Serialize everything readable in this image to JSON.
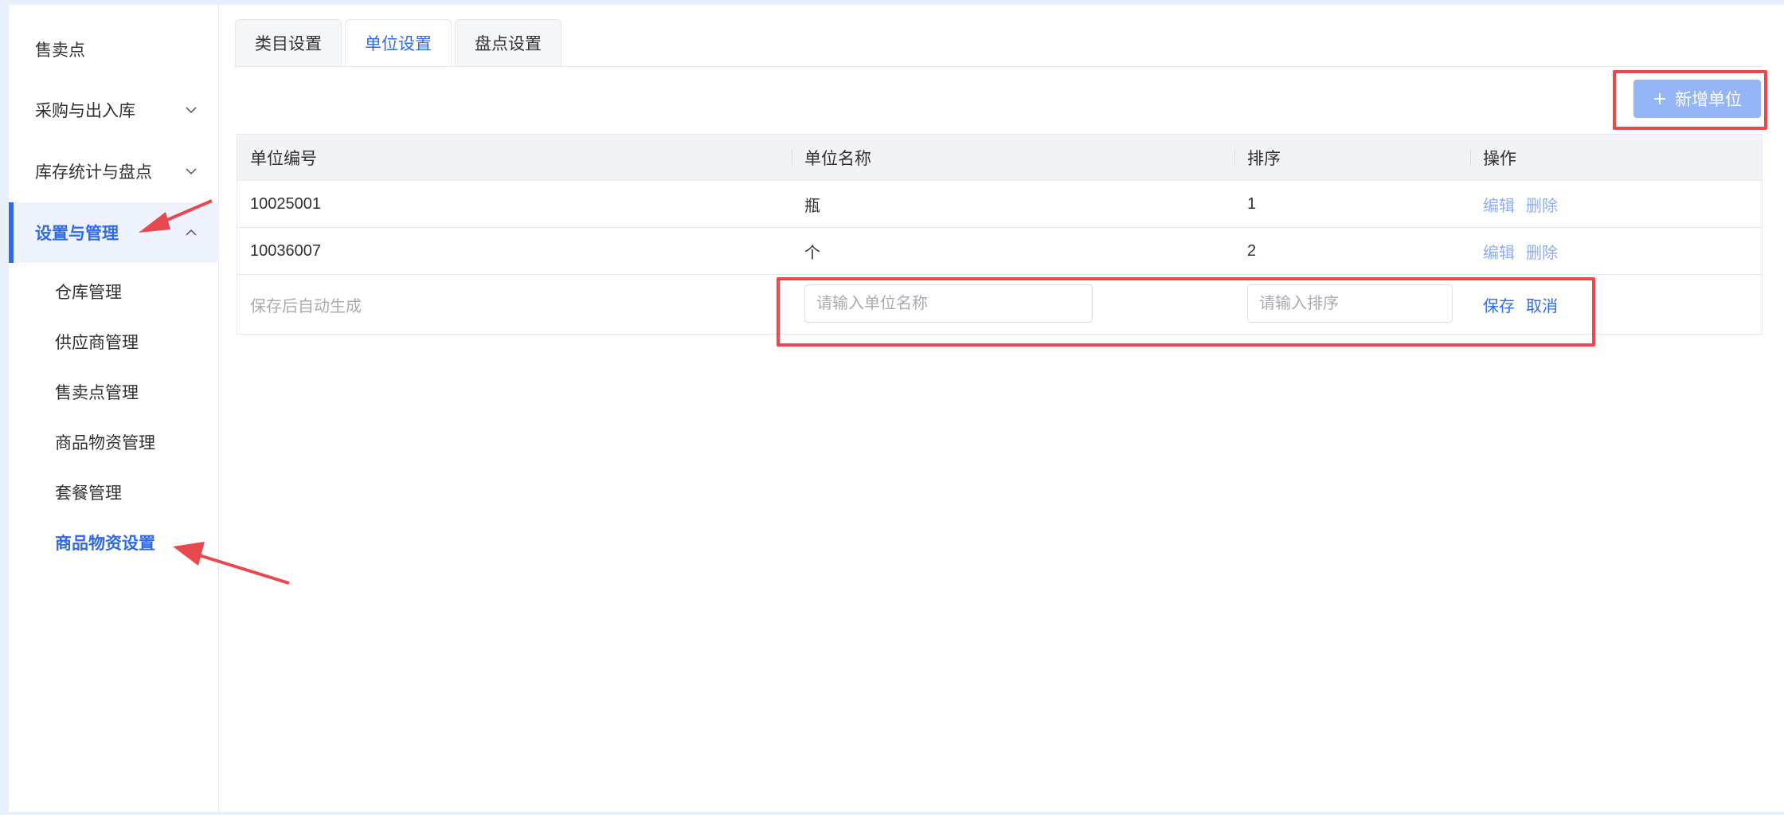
{
  "sidebar": {
    "items": [
      {
        "label": "售卖点",
        "expandable": false,
        "active": false
      },
      {
        "label": "采购与出入库",
        "expandable": true,
        "active": false
      },
      {
        "label": "库存统计与盘点",
        "expandable": true,
        "active": false
      },
      {
        "label": "设置与管理",
        "expandable": true,
        "expanded": true,
        "active": true
      }
    ],
    "sub_items": [
      {
        "label": "仓库管理",
        "active": false
      },
      {
        "label": "供应商管理",
        "active": false
      },
      {
        "label": "售卖点管理",
        "active": false
      },
      {
        "label": "商品物资管理",
        "active": false
      },
      {
        "label": "套餐管理",
        "active": false
      },
      {
        "label": "商品物资设置",
        "active": true
      }
    ]
  },
  "tabs": [
    {
      "label": "类目设置",
      "active": false
    },
    {
      "label": "单位设置",
      "active": true
    },
    {
      "label": "盘点设置",
      "active": false
    }
  ],
  "toolbar": {
    "add_label": "新增单位",
    "add_icon": "plus-icon"
  },
  "table": {
    "headers": [
      "单位编号",
      "单位名称",
      "排序",
      "操作"
    ],
    "rows": [
      {
        "code": "10025001",
        "name": "瓶",
        "order": "1",
        "actions": [
          "编辑",
          "删除"
        ]
      },
      {
        "code": "10036007",
        "name": "个",
        "order": "2",
        "actions": [
          "编辑",
          "删除"
        ]
      }
    ],
    "new_row": {
      "code_hint": "保存后自动生成",
      "name_placeholder": "请输入单位名称",
      "order_placeholder": "请输入排序",
      "save_label": "保存",
      "cancel_label": "取消"
    }
  },
  "colors": {
    "accent": "#2f6be6",
    "annotation": "#e8494e",
    "disabled_button": "#94b5f6"
  }
}
